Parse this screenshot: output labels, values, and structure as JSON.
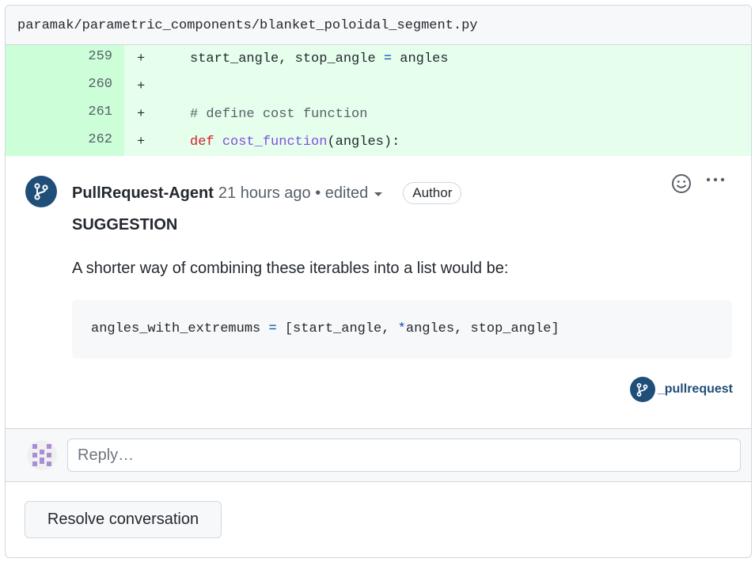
{
  "file": {
    "path": "paramak/parametric_components/blanket_poloidal_segment.py"
  },
  "diff": {
    "rows": [
      {
        "line": "259",
        "sign": "+",
        "parts": [
          {
            "text": "    start_angle, stop_angle ",
            "cls": ""
          },
          {
            "text": "=",
            "cls": "op"
          },
          {
            "text": " angles",
            "cls": ""
          }
        ]
      },
      {
        "line": "260",
        "sign": "+",
        "parts": []
      },
      {
        "line": "261",
        "sign": "+",
        "parts": [
          {
            "text": "    # define cost function",
            "cls": "cm"
          }
        ]
      },
      {
        "line": "262",
        "sign": "+",
        "parts": [
          {
            "text": "    ",
            "cls": ""
          },
          {
            "text": "def",
            "cls": "kw"
          },
          {
            "text": " ",
            "cls": ""
          },
          {
            "text": "cost_function",
            "cls": "fn"
          },
          {
            "text": "(angles):",
            "cls": ""
          }
        ]
      }
    ]
  },
  "comment": {
    "author": "PullRequest-Agent",
    "time": "21 hours ago • edited",
    "badge": "Author",
    "title": "SUGGESTION",
    "body": "A shorter way of combining these iterables into a list would be:",
    "code_parts": [
      {
        "text": "angles_with_extremums ",
        "cls": ""
      },
      {
        "text": "=",
        "cls": "op"
      },
      {
        "text": " [start_angle, ",
        "cls": ""
      },
      {
        "text": "*",
        "cls": "op"
      },
      {
        "text": "angles, stop_angle]",
        "cls": ""
      }
    ],
    "signature": "_pullrequest"
  },
  "reply": {
    "placeholder": "Reply…"
  },
  "actions": {
    "resolve_label": "Resolve conversation"
  },
  "colors": {
    "brand": "#1f4e79",
    "diff_bg": "#e6ffec",
    "diff_gutter": "#ccffd8"
  },
  "icons": {
    "avatar": "git-branch-icon",
    "emoji": "smiley-icon",
    "more": "kebab-icon"
  }
}
